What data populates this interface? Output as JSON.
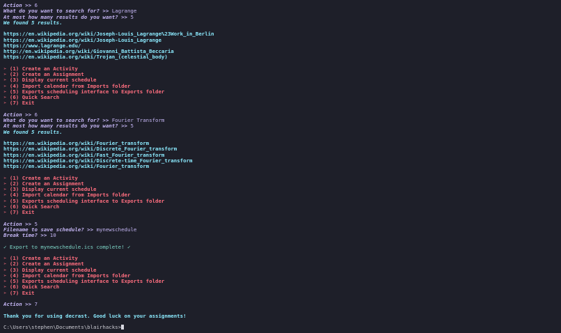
{
  "blocks": [
    {
      "type": "action",
      "prompt": "Action >> ",
      "value": "6"
    },
    {
      "type": "search",
      "question": "What do you want to search for? >> ",
      "value": "Lagrange"
    },
    {
      "type": "count",
      "question": "At most how many results do you want? >> ",
      "value": "5"
    },
    {
      "type": "info",
      "text": "We found 5 results."
    },
    {
      "type": "blank"
    },
    {
      "type": "url",
      "text": "https://en.wikipedia.org/wiki/Joseph-Louis_Lagrange%23Work_in_Berlin"
    },
    {
      "type": "url",
      "text": "https://en.wikipedia.org/wiki/Joseph-Louis_Lagrange"
    },
    {
      "type": "url",
      "text": "https://www.lagrange.edu/"
    },
    {
      "type": "url",
      "text": "http://en.wikipedia.org/wiki/Giovanni_Battista_Beccaria"
    },
    {
      "type": "url",
      "text": "https://en.wikipedia.org/wiki/Trojan_(celestial_body)"
    },
    {
      "type": "blank"
    },
    {
      "type": "menu",
      "text": "➢ (1) Create an Activity"
    },
    {
      "type": "menu",
      "text": "➢ (2) Create an Assignment"
    },
    {
      "type": "menu",
      "text": "➢ (3) Display current schedule"
    },
    {
      "type": "menu",
      "text": "➢ (4) Import calendar from Imports folder"
    },
    {
      "type": "menu",
      "text": "➢ (5) Exports scheduling interface to Exports folder"
    },
    {
      "type": "menu",
      "text": "➢ (6) Quick Search"
    },
    {
      "type": "menu",
      "text": "➢ (7) Exit"
    },
    {
      "type": "blank"
    },
    {
      "type": "action",
      "prompt": "Action >> ",
      "value": "6"
    },
    {
      "type": "search",
      "question": "What do you want to search for? >> ",
      "value": "Fourier Transform"
    },
    {
      "type": "count",
      "question": "At most how many results do you want? >> ",
      "value": "5"
    },
    {
      "type": "info",
      "text": "We found 5 results."
    },
    {
      "type": "blank"
    },
    {
      "type": "url",
      "text": "https://en.wikipedia.org/wiki/Fourier_transform"
    },
    {
      "type": "url",
      "text": "https://en.wikipedia.org/wiki/Discrete_Fourier_transform"
    },
    {
      "type": "url",
      "text": "https://en.wikipedia.org/wiki/Fast_Fourier_transform"
    },
    {
      "type": "url",
      "text": "https://en.wikipedia.org/wiki/Discrete-time_Fourier_transform"
    },
    {
      "type": "url",
      "text": "https://en.wikipedia.org/wiki/Fourier_transform"
    },
    {
      "type": "blank"
    },
    {
      "type": "menu",
      "text": "➢ (1) Create an Activity"
    },
    {
      "type": "menu",
      "text": "➢ (2) Create an Assignment"
    },
    {
      "type": "menu",
      "text": "➢ (3) Display current schedule"
    },
    {
      "type": "menu",
      "text": "➢ (4) Import calendar from Imports folder"
    },
    {
      "type": "menu",
      "text": "➢ (5) Exports scheduling interface to Exports folder"
    },
    {
      "type": "menu",
      "text": "➢ (6) Quick Search"
    },
    {
      "type": "menu",
      "text": "➢ (7) Exit"
    },
    {
      "type": "blank"
    },
    {
      "type": "action",
      "prompt": "Action >> ",
      "value": "5"
    },
    {
      "type": "filename",
      "question": "Filename to save schedule? >> ",
      "value": "mynewschedule"
    },
    {
      "type": "break",
      "question": "Break time? >> ",
      "value": "10"
    },
    {
      "type": "blank"
    },
    {
      "type": "success",
      "text": "✓ Export to mynewschedule.ics complete! ✓"
    },
    {
      "type": "blank"
    },
    {
      "type": "menu",
      "text": "➢ (1) Create an Activity"
    },
    {
      "type": "menu",
      "text": "➢ (2) Create an Assignment"
    },
    {
      "type": "menu",
      "text": "➢ (3) Display current schedule"
    },
    {
      "type": "menu",
      "text": "➢ (4) Import calendar from Imports folder"
    },
    {
      "type": "menu",
      "text": "➢ (5) Exports scheduling interface to Exports folder"
    },
    {
      "type": "menu",
      "text": "➢ (6) Quick Search"
    },
    {
      "type": "menu",
      "text": "➢ (7) Exit"
    },
    {
      "type": "blank"
    },
    {
      "type": "action",
      "prompt": "Action >> ",
      "value": "7"
    },
    {
      "type": "blank"
    },
    {
      "type": "goodbye",
      "text": "Thank you for using decrast. Good luck on your assignments!"
    },
    {
      "type": "blank"
    },
    {
      "type": "shell",
      "text": "C:\\Users\\stephen\\Documents\\blairhacks>"
    }
  ],
  "colors": {
    "background": "#1e1f29",
    "prompt": "#c3b4f2",
    "info": "#8be9fd",
    "menu": "#ff6e7f",
    "success": "#7fd8c9"
  },
  "icons": {
    "menu_bullet": "arrowhead-icon",
    "success_mark": "check-icon",
    "cursor": "block-cursor"
  }
}
